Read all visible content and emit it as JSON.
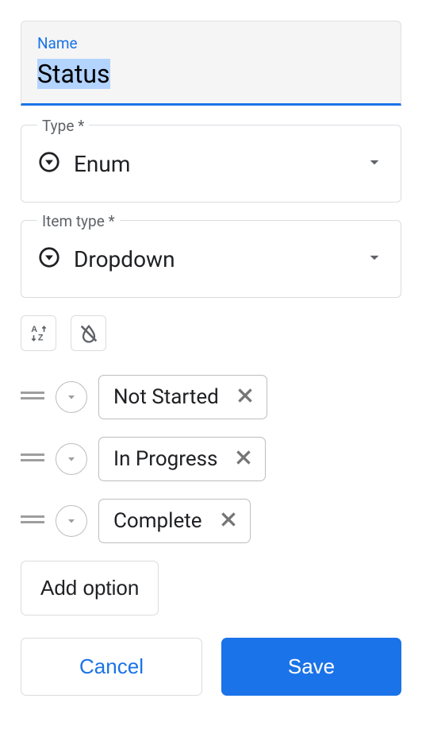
{
  "name_field": {
    "label": "Name",
    "value": "Status"
  },
  "type_field": {
    "label": "Type *",
    "value": "Enum"
  },
  "item_type_field": {
    "label": "Item type *",
    "value": "Dropdown"
  },
  "options": [
    {
      "label": "Not Started"
    },
    {
      "label": "In Progress"
    },
    {
      "label": "Complete"
    }
  ],
  "add_option_label": "Add option",
  "footer": {
    "cancel": "Cancel",
    "save": "Save"
  }
}
